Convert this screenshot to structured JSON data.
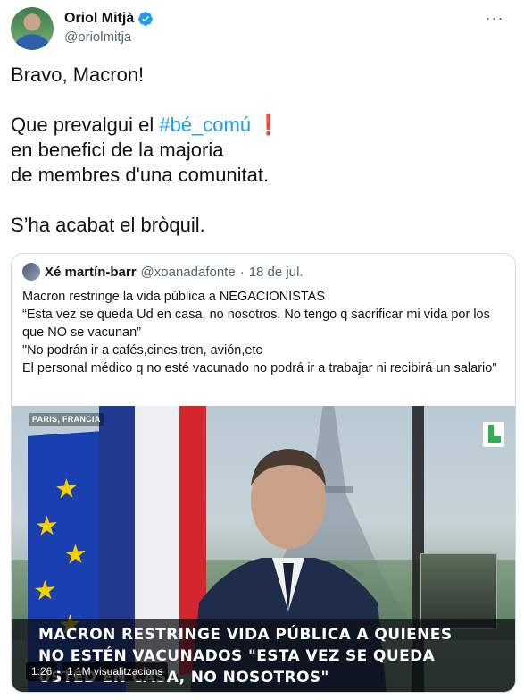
{
  "author": {
    "display_name": "Oriol Mitjà",
    "handle": "@oriolmitja",
    "verified": true
  },
  "tweet": {
    "line1": "Bravo, Macron!",
    "line2_prefix": "Que prevalgui el ",
    "hashtag": "#bé_comú",
    "exclaim_icon": "❗",
    "line3": "en benefici de la majoria",
    "line4": "de membres d'una comunitat.",
    "line5": "S’ha acabat el bròquil."
  },
  "quoted": {
    "display_name": "Xé martín-barr",
    "handle": "@xoanadafonte",
    "separator": "·",
    "date": "18 de jul.",
    "lines": [
      "Macron restringe la vida pública a NEGACIONISTAS",
      "“Esta vez se queda Ud en casa, no nosotros. No tengo q sacrificar mi vida por los que NO se vacunan”",
      "\"No podrán ir a cafés,cines,tren, avión,etc",
      "El personal médico q no esté vacunado no podrá ir a trabajar ni recibirá un salario\""
    ]
  },
  "video": {
    "location_tag": "PARIS, FRANCIA",
    "caption_line1": "MACRON RESTRINGE VIDA PÚBLICA A QUIENES",
    "caption_line2": "NO ESTÉN VACUNADOS \"ESTA VEZ SE QUEDA",
    "caption_line3": "USTED EN CASA, NO NOSOTROS\"",
    "duration": "1:26",
    "views": "1,1M visualitzacions"
  },
  "colors": {
    "accent": "#1d9bf0",
    "text": "#0f1419",
    "muted": "#536471",
    "border": "#cfd9de"
  },
  "icons": {
    "verified": "verified-badge-icon",
    "more": "more-options-icon"
  }
}
